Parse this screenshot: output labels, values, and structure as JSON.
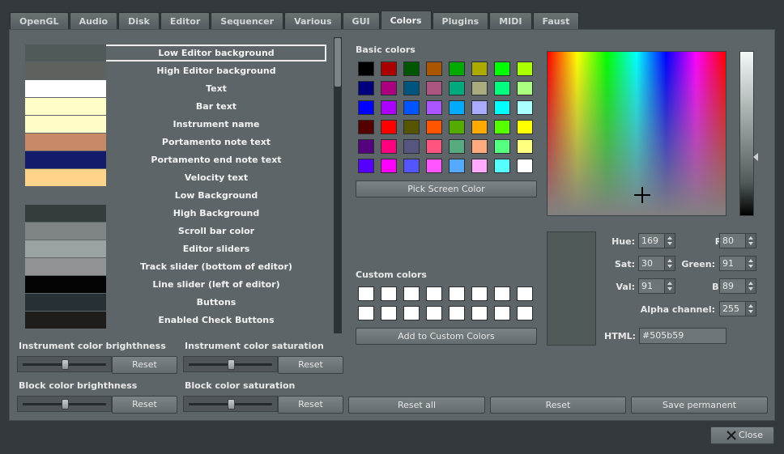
{
  "tabs": [
    {
      "label": "OpenGL",
      "active": false
    },
    {
      "label": "Audio",
      "active": false
    },
    {
      "label": "Disk",
      "active": false
    },
    {
      "label": "Editor",
      "active": false
    },
    {
      "label": "Sequencer",
      "active": false
    },
    {
      "label": "Various",
      "active": false
    },
    {
      "label": "GUI",
      "active": false
    },
    {
      "label": "Colors",
      "active": true
    },
    {
      "label": "Plugins",
      "active": false
    },
    {
      "label": "MIDI",
      "active": false
    },
    {
      "label": "Faust",
      "active": false
    }
  ],
  "color_list": [
    {
      "label": "Low Editor background",
      "color": "#505b59",
      "selected": true
    },
    {
      "label": "High Editor background",
      "color": "#5d625f"
    },
    {
      "label": "Text",
      "color": "#ffffff"
    },
    {
      "label": "Bar text",
      "color": "#fffec9"
    },
    {
      "label": "Instrument name",
      "color": "#fefdc7"
    },
    {
      "label": "Portamento note text",
      "color": "#c88a66"
    },
    {
      "label": "Portamento end note text",
      "color": "#141b6b"
    },
    {
      "label": "Velocity text",
      "color": "#fed38a"
    },
    {
      "label": "Low Background",
      "color": "#5e6568"
    },
    {
      "label": "High Background",
      "color": "#343c3e"
    },
    {
      "label": "Scroll bar color",
      "color": "#7f8486"
    },
    {
      "label": "Editor sliders",
      "color": "#9aa2a3"
    },
    {
      "label": "Track slider (bottom of editor)",
      "color": "#929394"
    },
    {
      "label": "Line slider (left of editor)",
      "color": "#040404"
    },
    {
      "label": "Buttons",
      "color": "#263035"
    },
    {
      "label": "Enabled Check Buttons",
      "color": "#1f1d1a"
    }
  ],
  "adjust": {
    "instrument_brightness": {
      "label": "Instrument color brighthness",
      "value": 0.5
    },
    "instrument_saturation": {
      "label": "Instrument color saturation",
      "value": 0.5
    },
    "block_brightness": {
      "label": "Block color brighthness",
      "value": 0.5
    },
    "block_saturation": {
      "label": "Block color saturation",
      "value": 0.5
    },
    "reset_label": "Reset"
  },
  "basic_colors": {
    "label": "Basic colors",
    "rows": [
      [
        "#000000",
        "#aa0000",
        "#005500",
        "#aa5500",
        "#00aa00",
        "#aaaa00",
        "#00ff00",
        "#aaff00"
      ],
      [
        "#00007f",
        "#aa007f",
        "#00557f",
        "#aa557f",
        "#00aa7f",
        "#aaaa7f",
        "#00ff7f",
        "#aaff7f"
      ],
      [
        "#0000ff",
        "#aa00ff",
        "#0055ff",
        "#aa55ff",
        "#00aaff",
        "#aaaaff",
        "#00ffff",
        "#aaffff"
      ],
      [
        "#550000",
        "#ff0000",
        "#555500",
        "#ff5500",
        "#55aa00",
        "#ffaa00",
        "#55ff00",
        "#ffff00"
      ],
      [
        "#55007f",
        "#ff007f",
        "#55557f",
        "#ff557f",
        "#55aa7f",
        "#ffaa7f",
        "#55ff7f",
        "#ffff7f"
      ],
      [
        "#5500ff",
        "#ff00ff",
        "#5555ff",
        "#ff55ff",
        "#55aaff",
        "#ffaaff",
        "#55ffff",
        "#ffffff"
      ]
    ]
  },
  "pick_screen_label": "Pick Screen Color",
  "custom_colors": {
    "label": "Custom colors",
    "rows": [
      [
        "#ffffff",
        "#ffffff",
        "#ffffff",
        "#ffffff",
        "#ffffff",
        "#ffffff",
        "#ffffff",
        "#ffffff"
      ],
      [
        "#ffffff",
        "#ffffff",
        "#ffffff",
        "#ffffff",
        "#ffffff",
        "#ffffff",
        "#ffffff",
        "#ffffff"
      ]
    ]
  },
  "add_custom_label": "Add to Custom Colors",
  "current_color": "#505b59",
  "fields": {
    "hue": {
      "label": "Hue:",
      "value": "169"
    },
    "sat": {
      "label": "Sat:",
      "value": "30"
    },
    "val": {
      "label": "Val:",
      "value": "91"
    },
    "red": {
      "label": "Red:",
      "value": "80"
    },
    "green": {
      "label": "Green:",
      "value": "91"
    },
    "blue": {
      "label": "Blue:",
      "value": "89"
    },
    "alpha": {
      "label": "Alpha channel:",
      "value": "255"
    },
    "html": {
      "label": "HTML:",
      "value": "#505b59"
    }
  },
  "buttons": {
    "reset_all": "Reset all",
    "reset": "Reset",
    "save_permanent": "Save permanent",
    "close": "Close"
  }
}
